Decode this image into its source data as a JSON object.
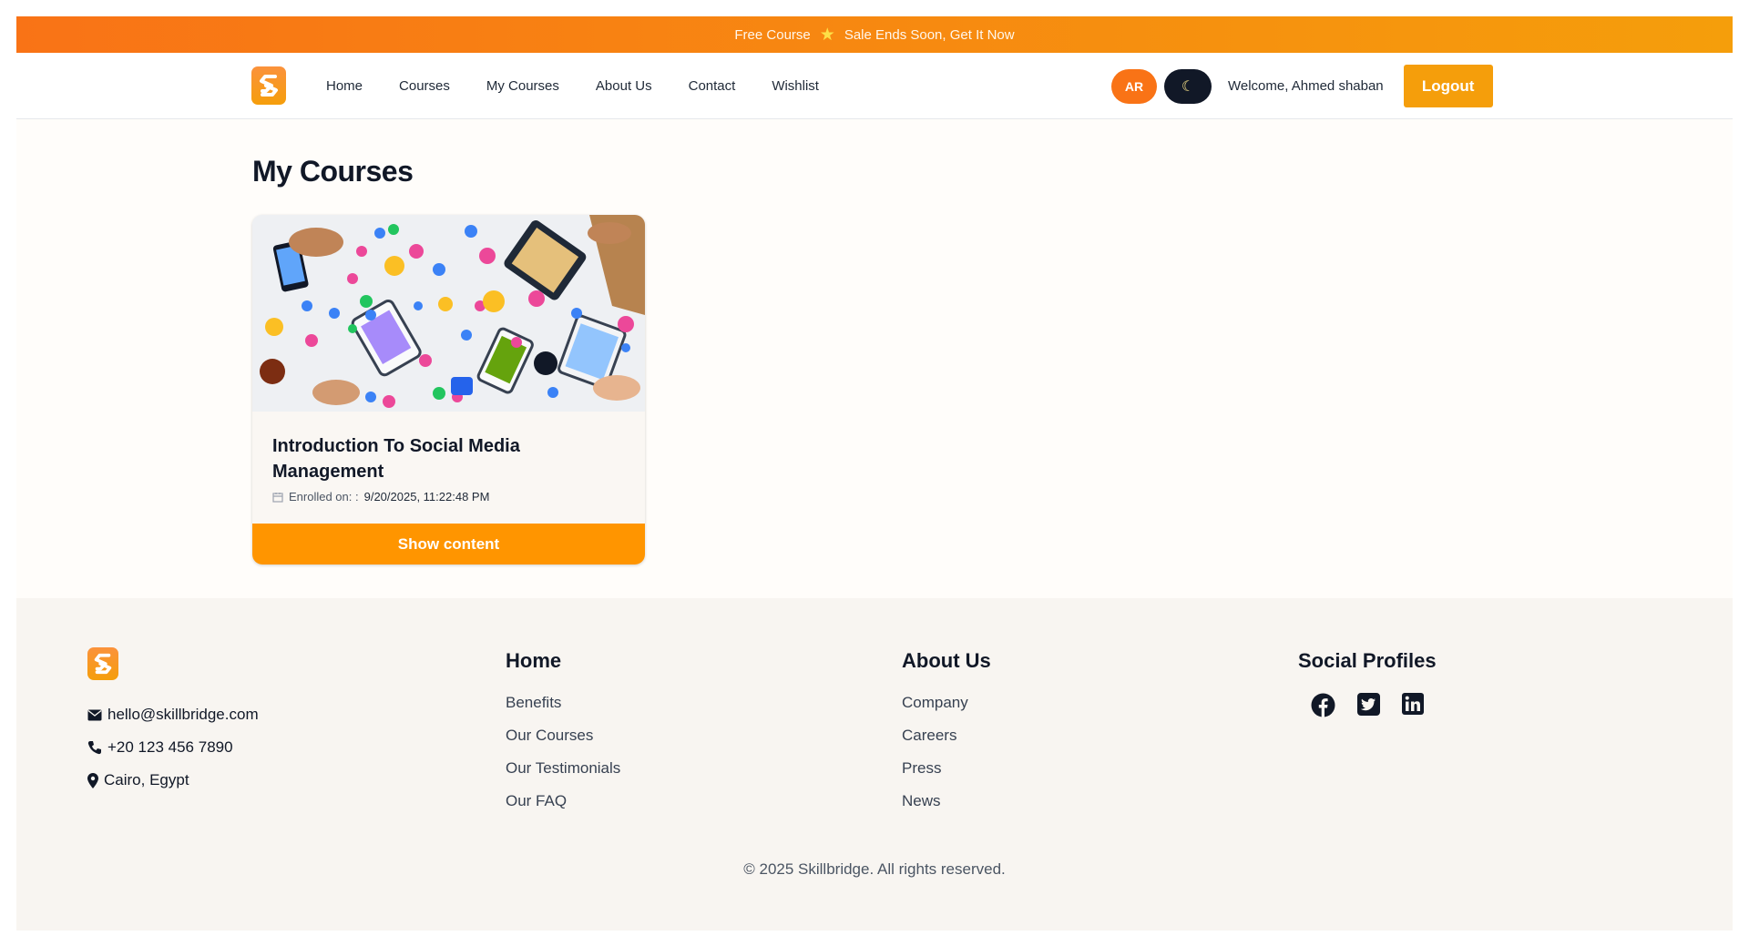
{
  "promo": {
    "left_text": "Free Course",
    "right_text": "Sale Ends Soon, Get It Now",
    "icon": "star-icon"
  },
  "nav": {
    "links": [
      "Home",
      "Courses",
      "My Courses",
      "About Us",
      "Contact",
      "Wishlist"
    ],
    "lang_label": "AR",
    "theme_icon": "moon-icon",
    "welcome": "Welcome, Ahmed shaban",
    "logout_label": "Logout"
  },
  "main": {
    "title": "My Courses",
    "courses": [
      {
        "title": "Introduction To Social Media Management",
        "enrolled_label": "Enrolled on: :",
        "enrolled_date": "9/20/2025, 11:22:48 PM",
        "button_label": "Show content"
      }
    ]
  },
  "footer": {
    "contact": {
      "email": "hello@skillbridge.com",
      "phone": "+20 123 456 7890",
      "location": "Cairo, Egypt"
    },
    "home_col": {
      "heading": "Home",
      "links": [
        "Benefits",
        "Our Courses",
        "Our Testimonials",
        "Our FAQ"
      ]
    },
    "about_col": {
      "heading": "About Us",
      "links": [
        "Company",
        "Careers",
        "Press",
        "News"
      ]
    },
    "social_col": {
      "heading": "Social Profiles",
      "icons": [
        "facebook-icon",
        "twitter-icon",
        "linkedin-icon"
      ]
    },
    "copyright": "© 2025 Skillbridge. All rights reserved."
  },
  "colors": {
    "accent": "#f97316",
    "button": "#ff9500",
    "dark": "#111827"
  }
}
